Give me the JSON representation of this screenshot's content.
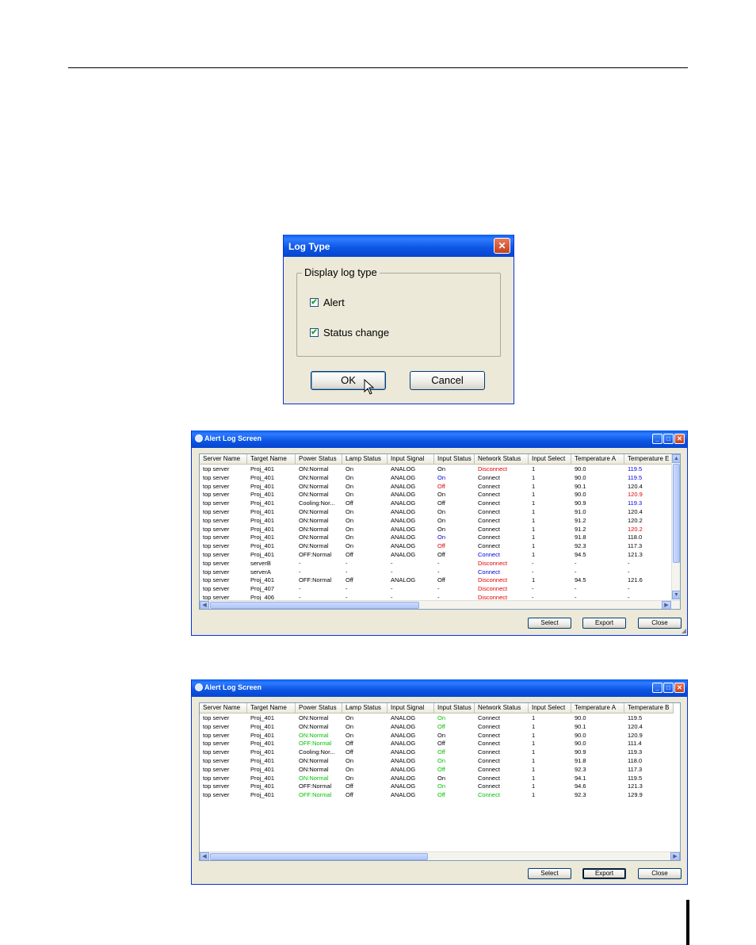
{
  "log_type_dialog": {
    "title": "Log Type",
    "group_label": "Display log type",
    "options": [
      {
        "label": "Alert",
        "checked": true
      },
      {
        "label": "Status change",
        "checked": true
      }
    ],
    "ok_label": "OK",
    "cancel_label": "Cancel"
  },
  "columns": [
    "Server Name",
    "Target Name",
    "Power Status",
    "Lamp Status",
    "Input Signal",
    "Input Status",
    "Network Status",
    "Input Select",
    "Temperature A",
    "Temperature B"
  ],
  "alert_window_1": {
    "title": "Alert Log Screen",
    "header_last": "Temperature E",
    "rows": [
      {
        "cells": [
          "top server",
          "Proj_401",
          "ON:Normal",
          "On",
          "ANALOG",
          "On",
          "Disconnect",
          "1",
          "90.0",
          "119.5"
        ],
        "colors": {
          "6": "red",
          "9": "blue"
        }
      },
      {
        "cells": [
          "top server",
          "Proj_401",
          "ON:Normal",
          "On",
          "ANALOG",
          "On",
          "Connect",
          "1",
          "90.0",
          "119.5"
        ],
        "colors": {
          "5": "blue",
          "9": "blue"
        }
      },
      {
        "cells": [
          "top server",
          "Proj_401",
          "ON:Normal",
          "On",
          "ANALOG",
          "Off",
          "Connect",
          "1",
          "90.1",
          "120.4"
        ],
        "colors": {
          "5": "red"
        }
      },
      {
        "cells": [
          "top server",
          "Proj_401",
          "ON:Normal",
          "On",
          "ANALOG",
          "On",
          "Connect",
          "1",
          "90.0",
          "120.9"
        ],
        "colors": {
          "9": "red"
        }
      },
      {
        "cells": [
          "top server",
          "Proj_401",
          "Cooling:Nor...",
          "Off",
          "ANALOG",
          "Off",
          "Connect",
          "1",
          "90.9",
          "119.3"
        ],
        "colors": {
          "9": "blue"
        }
      },
      {
        "cells": [
          "top server",
          "Proj_401",
          "ON:Normal",
          "On",
          "ANALOG",
          "On",
          "Connect",
          "1",
          "91.0",
          "120.4"
        ],
        "colors": {}
      },
      {
        "cells": [
          "top server",
          "Proj_401",
          "ON:Normal",
          "On",
          "ANALOG",
          "On",
          "Connect",
          "1",
          "91.2",
          "120.2"
        ],
        "colors": {}
      },
      {
        "cells": [
          "top server",
          "Proj_401",
          "ON:Normal",
          "On",
          "ANALOG",
          "On",
          "Connect",
          "1",
          "91.2",
          "120.2"
        ],
        "colors": {
          "9": "red"
        }
      },
      {
        "cells": [
          "top server",
          "Proj_401",
          "ON:Normal",
          "On",
          "ANALOG",
          "On",
          "Connect",
          "1",
          "91.8",
          "118.0"
        ],
        "colors": {
          "5": "blue"
        }
      },
      {
        "cells": [
          "top server",
          "Proj_401",
          "ON:Normal",
          "On",
          "ANALOG",
          "Off",
          "Connect",
          "1",
          "92.3",
          "117.3"
        ],
        "colors": {
          "5": "red"
        }
      },
      {
        "cells": [
          "top server",
          "Proj_401",
          "OFF:Normal",
          "Off",
          "ANALOG",
          "Off",
          "Connect",
          "1",
          "94.5",
          "121.3"
        ],
        "colors": {
          "6": "blue"
        }
      },
      {
        "cells": [
          "top server",
          "serverB",
          "-",
          "-",
          "-",
          "-",
          "Disconnect",
          "-",
          "-",
          "-"
        ],
        "colors": {
          "6": "red"
        }
      },
      {
        "cells": [
          "top server",
          "serverA",
          "-",
          "-",
          "-",
          "-",
          "Connect",
          "-",
          "-",
          "-"
        ],
        "colors": {
          "6": "blue"
        }
      },
      {
        "cells": [
          "top server",
          "Proj_401",
          "OFF:Normal",
          "Off",
          "ANALOG",
          "Off",
          "Disconnect",
          "1",
          "94.5",
          "121.6"
        ],
        "colors": {
          "6": "red"
        }
      },
      {
        "cells": [
          "top server",
          "Proj_407",
          "-",
          "-",
          "-",
          "-",
          "Disconnect",
          "-",
          "-",
          "-"
        ],
        "colors": {
          "6": "red"
        }
      },
      {
        "cells": [
          "top server",
          "Proj_406",
          "-",
          "-",
          "-",
          "-",
          "Disconnect",
          "-",
          "-",
          "-"
        ],
        "colors": {
          "6": "red"
        }
      }
    ],
    "buttons": [
      "Select",
      "Export",
      "Close"
    ]
  },
  "alert_window_2": {
    "title": "Alert Log Screen",
    "header_last": "Temperature B",
    "rows": [
      {
        "cells": [
          "top server",
          "Proj_401",
          "ON:Normal",
          "On",
          "ANALOG",
          "On",
          "Connect",
          "1",
          "90.0",
          "119.5"
        ],
        "colors": {
          "5": "green"
        }
      },
      {
        "cells": [
          "top server",
          "Proj_401",
          "ON:Normal",
          "On",
          "ANALOG",
          "Off",
          "Connect",
          "1",
          "90.1",
          "120.4"
        ],
        "colors": {
          "5": "green"
        }
      },
      {
        "cells": [
          "top server",
          "Proj_401",
          "ON:Normal",
          "On",
          "ANALOG",
          "On",
          "Connect",
          "1",
          "90.0",
          "120.9"
        ],
        "colors": {
          "2": "green"
        }
      },
      {
        "cells": [
          "top server",
          "Proj_401",
          "OFF:Normal",
          "Off",
          "ANALOG",
          "Off",
          "Connect",
          "1",
          "90.0",
          "111.4"
        ],
        "colors": {
          "2": "green"
        }
      },
      {
        "cells": [
          "top server",
          "Proj_401",
          "Cooling:Nor...",
          "Off",
          "ANALOG",
          "Off",
          "Connect",
          "1",
          "90.9",
          "119.3"
        ],
        "colors": {
          "5": "green"
        }
      },
      {
        "cells": [
          "top server",
          "Proj_401",
          "ON:Normal",
          "On",
          "ANALOG",
          "On",
          "Connect",
          "1",
          "91.8",
          "118.0"
        ],
        "colors": {
          "5": "green"
        }
      },
      {
        "cells": [
          "top server",
          "Proj_401",
          "ON:Normal",
          "On",
          "ANALOG",
          "Off",
          "Connect",
          "1",
          "92.3",
          "117.3"
        ],
        "colors": {
          "5": "green"
        }
      },
      {
        "cells": [
          "top server",
          "Proj_401",
          "ON:Normal",
          "On",
          "ANALOG",
          "On",
          "Connect",
          "1",
          "94.1",
          "119.5"
        ],
        "colors": {
          "2": "green"
        }
      },
      {
        "cells": [
          "top server",
          "Proj_401",
          "OFF:Normal",
          "Off",
          "ANALOG",
          "On",
          "Connect",
          "1",
          "94.6",
          "121.3"
        ],
        "colors": {
          "5": "green"
        }
      },
      {
        "cells": [
          "top server",
          "Proj_401",
          "OFF:Normal",
          "Off",
          "ANALOG",
          "Off",
          "Connect",
          "1",
          "92.3",
          "129.9"
        ],
        "colors": {
          "2": "green",
          "5": "green",
          "6": "green"
        }
      }
    ],
    "buttons": [
      "Select",
      "Export",
      "Close"
    ]
  }
}
